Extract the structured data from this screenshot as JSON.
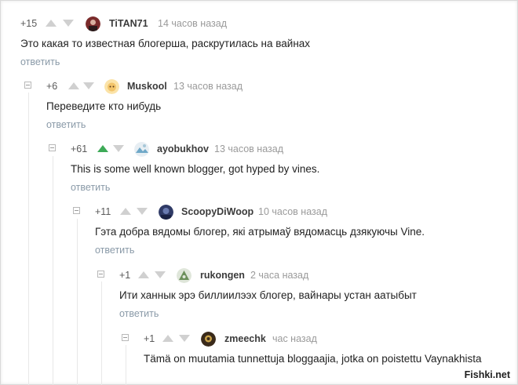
{
  "comments": [
    {
      "rating": "+15",
      "author": "TiTAN71",
      "time": "14 часов назад",
      "text": "Это какая то известная блогерша, раскрутилась на вайнах",
      "reply": "ответить",
      "upvoted": false,
      "avatar_color": "#7a2b2b"
    },
    {
      "rating": "+6",
      "author": "Muskool",
      "time": "13 часов назад",
      "text": "Переведите кто нибудь",
      "reply": "ответить",
      "upvoted": false,
      "avatar_color": "#f2c46a"
    },
    {
      "rating": "+61",
      "author": "ayobukhov",
      "time": "13 часов назад",
      "text": "This is some well known blogger, got hyped by vines.",
      "reply": "ответить",
      "upvoted": true,
      "avatar_color": "#6fa8c8"
    },
    {
      "rating": "+11",
      "author": "ScoopyDiWoop",
      "time": "10 часов назад",
      "text": "Гэта добра вядомы блогер, які атрымаў вядомасць дзякуючы Vine.",
      "reply": "ответить",
      "upvoted": false,
      "avatar_color": "#2f3a66"
    },
    {
      "rating": "+1",
      "author": "rukongen",
      "time": "2 часа назад",
      "text": "Ити ханнык эрэ биллиилээх блогер, вайнары устан аатыбыт",
      "reply": "ответить",
      "upvoted": false,
      "avatar_color": "#6b8f5a"
    },
    {
      "rating": "+1",
      "author": "zmeechk",
      "time": "час назад",
      "text": "Tämä on muutamia tunnettuja bloggaajia, jotka on poistettu Vaynakhista",
      "reply": "",
      "upvoted": false,
      "avatar_color": "#3a2a1a"
    }
  ],
  "watermark": "Fishki.net",
  "colors": {
    "upvote_active": "#3daa57",
    "arrow_idle": "#d0d0d0",
    "reply_link": "#8a9aa8"
  }
}
